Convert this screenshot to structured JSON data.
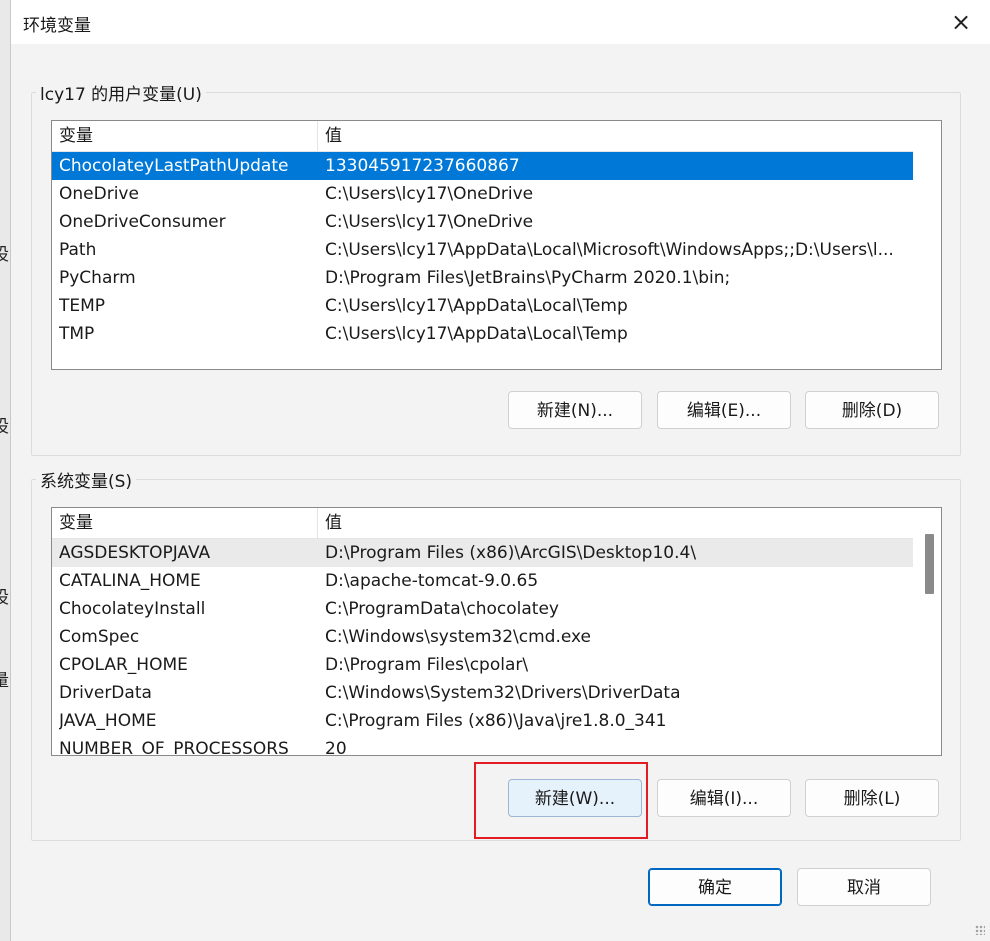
{
  "background": {
    "glyphs": [
      "设",
      "设",
      "设",
      "量"
    ]
  },
  "dialog": {
    "title": "环境变量",
    "close_icon": "×"
  },
  "user_group": {
    "legend": "lcy17 的用户变量(U)",
    "headers": {
      "variable": "变量",
      "value": "值"
    },
    "rows": [
      {
        "name": "ChocolateyLastPathUpdate",
        "value": "133045917237660867"
      },
      {
        "name": "OneDrive",
        "value": "C:\\Users\\lcy17\\OneDrive"
      },
      {
        "name": "OneDriveConsumer",
        "value": "C:\\Users\\lcy17\\OneDrive"
      },
      {
        "name": "Path",
        "value": "C:\\Users\\lcy17\\AppData\\Local\\Microsoft\\WindowsApps;;D:\\Users\\l..."
      },
      {
        "name": "PyCharm",
        "value": "D:\\Program Files\\JetBrains\\PyCharm 2020.1\\bin;"
      },
      {
        "name": "TEMP",
        "value": "C:\\Users\\lcy17\\AppData\\Local\\Temp"
      },
      {
        "name": "TMP",
        "value": "C:\\Users\\lcy17\\AppData\\Local\\Temp"
      }
    ],
    "selected_index": 0,
    "buttons": {
      "new": "新建(N)...",
      "edit": "编辑(E)...",
      "delete": "删除(D)"
    }
  },
  "system_group": {
    "legend": "系统变量(S)",
    "headers": {
      "variable": "变量",
      "value": "值"
    },
    "rows": [
      {
        "name": "AGSDESKTOPJAVA",
        "value": "D:\\Program Files (x86)\\ArcGIS\\Desktop10.4\\"
      },
      {
        "name": "CATALINA_HOME",
        "value": "D:\\apache-tomcat-9.0.65"
      },
      {
        "name": "ChocolateyInstall",
        "value": "C:\\ProgramData\\chocolatey"
      },
      {
        "name": "ComSpec",
        "value": "C:\\Windows\\system32\\cmd.exe"
      },
      {
        "name": "CPOLAR_HOME",
        "value": "D:\\Program Files\\cpolar\\"
      },
      {
        "name": "DriverData",
        "value": "C:\\Windows\\System32\\Drivers\\DriverData"
      },
      {
        "name": "JAVA_HOME",
        "value": "C:\\Program Files (x86)\\Java\\jre1.8.0_341"
      },
      {
        "name": "NUMBER_OF_PROCESSORS",
        "value": "20"
      }
    ],
    "buttons": {
      "new": "新建(W)...",
      "edit": "编辑(I)...",
      "delete": "删除(L)"
    }
  },
  "footer": {
    "ok": "确定",
    "cancel": "取消"
  },
  "colors": {
    "selection": "#0078d7",
    "highlight_box": "#e31b23",
    "primary_border": "#0067c0"
  }
}
